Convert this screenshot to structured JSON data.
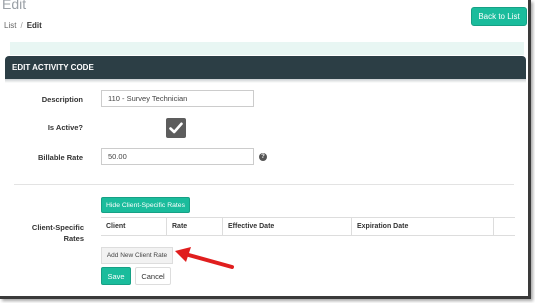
{
  "header": {
    "title": "Edit",
    "breadcrumb": {
      "parent": "List",
      "separator": "/",
      "current": "Edit"
    },
    "back_button": "Back to List"
  },
  "panel": {
    "title": "EDIT ACTIVITY CODE"
  },
  "form": {
    "description": {
      "label": "Description",
      "value": "110 - Survey Technician"
    },
    "is_active": {
      "label": "Is Active?",
      "checked": true
    },
    "billable_rate": {
      "label": "Billable Rate",
      "value": "50.00",
      "help_icon": "question-circle-icon"
    }
  },
  "client_rates": {
    "label": "Client-Specific Rates",
    "toggle_button": "Hide Client-Specific Rates",
    "columns": [
      "Client",
      "Rate",
      "Effective Date",
      "Expiration Date",
      ""
    ],
    "rows": [],
    "add_button": "Add New Client Rate"
  },
  "actions": {
    "save": "Save",
    "cancel": "Cancel"
  },
  "annotation": {
    "icon": "red-arrow-icon",
    "color": "#e01e1e"
  },
  "colors": {
    "accent": "#1abc9c",
    "panel_header": "#2c3e45",
    "alert_bg": "#e8f6f3"
  }
}
